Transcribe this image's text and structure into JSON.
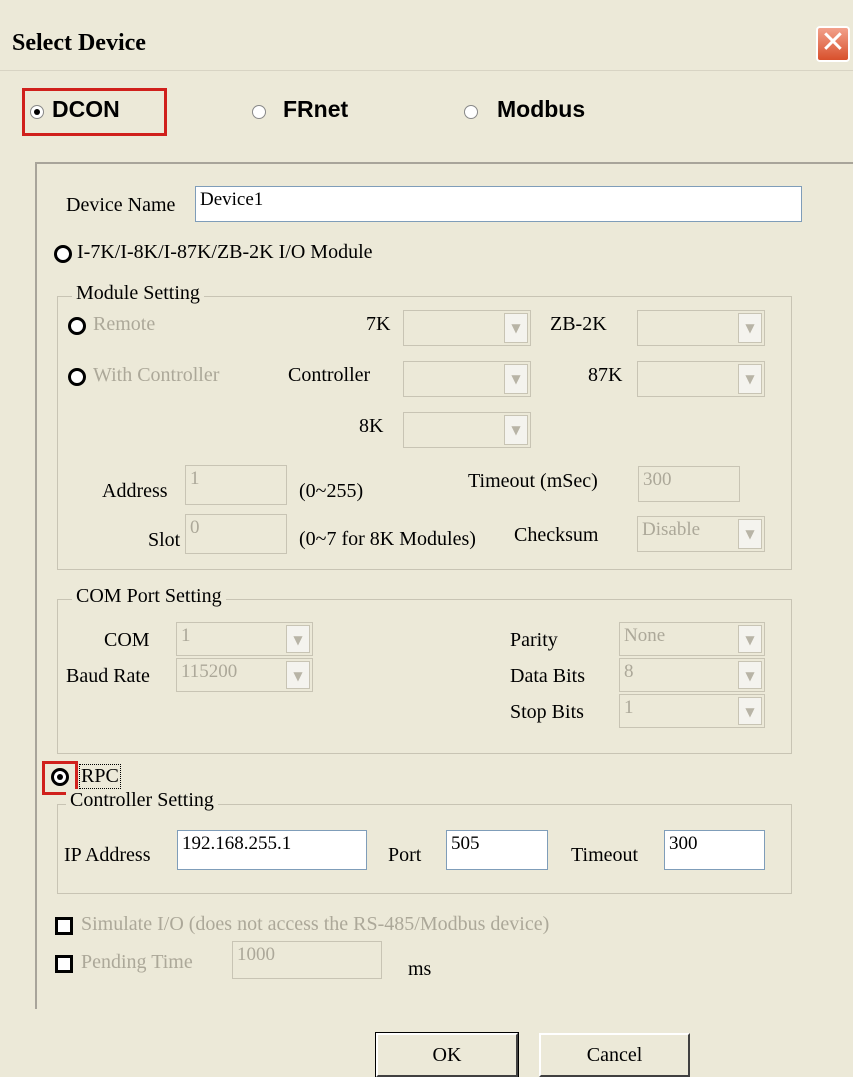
{
  "window": {
    "title": "Select Device",
    "close_glyph": "✕"
  },
  "protocols": [
    {
      "label": "DCON",
      "selected": true
    },
    {
      "label": "FRnet",
      "selected": false
    },
    {
      "label": "Modbus",
      "selected": false
    }
  ],
  "device_name": {
    "label": "Device Name",
    "value": "Device1"
  },
  "io_module_option": {
    "label": "I-7K/I-8K/I-87K/ZB-2K I/O Module"
  },
  "module_setting": {
    "title": "Module Setting",
    "remote_label": "Remote",
    "with_controller_label": "With Controller",
    "k7_label": "7K",
    "zb2k_label": "ZB-2K",
    "controller_label": "Controller",
    "k87_label": "87K",
    "k8_label": "8K",
    "address_label": "Address",
    "address_value": "1",
    "address_range": "(0~255)",
    "timeout_label": "Timeout (mSec)",
    "timeout_value": "300",
    "slot_label": "Slot",
    "slot_value": "0",
    "slot_range": "(0~7 for 8K Modules)",
    "checksum_label": "Checksum",
    "checksum_value": "Disable"
  },
  "com_port_setting": {
    "title": "COM Port Setting",
    "com_label": "COM",
    "com_value": "1",
    "baud_label": "Baud Rate",
    "baud_value": "115200",
    "parity_label": "Parity",
    "parity_value": "None",
    "databits_label": "Data Bits",
    "databits_value": "8",
    "stopbits_label": "Stop Bits",
    "stopbits_value": "1"
  },
  "rpc_option": {
    "label": "RPC",
    "selected": true
  },
  "controller_setting": {
    "title": "Controller Setting",
    "ip_label": "IP Address",
    "ip_value": "192.168.255.1",
    "port_label": "Port",
    "port_value": "505",
    "timeout_label": "Timeout",
    "timeout_value": "300"
  },
  "simulate_io": {
    "label": "Simulate I/O (does not access the RS-485/Modbus device)"
  },
  "pending_time": {
    "label": "Pending Time",
    "value": "1000",
    "unit": "ms"
  },
  "buttons": {
    "ok": "OK",
    "cancel": "Cancel"
  },
  "colors": {
    "highlight": "#d0201c",
    "dialog_bg": "#ece9d8",
    "close_button": "#d8502c"
  }
}
